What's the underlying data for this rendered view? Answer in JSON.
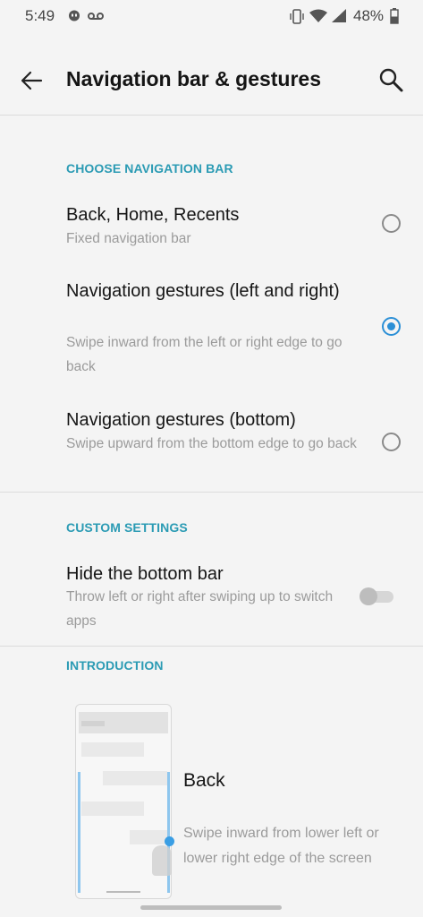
{
  "status_bar": {
    "time": "5:49",
    "battery": "48%",
    "icons": [
      "hangouts-icon",
      "voicemail-icon",
      "vibrate-icon",
      "wifi-icon",
      "signal-icon",
      "battery-icon"
    ]
  },
  "header": {
    "title": "Navigation bar & gestures",
    "back_icon": "back-arrow-icon",
    "search_icon": "search-icon"
  },
  "sections": {
    "choose": {
      "header": "CHOOSE NAVIGATION BAR",
      "options": [
        {
          "title": "Back, Home, Recents",
          "subtitle": "Fixed navigation bar",
          "selected": false
        },
        {
          "title": "Navigation gestures (left and right)",
          "subtitle": "Swipe inward from the left or right edge to go back",
          "selected": true
        },
        {
          "title": "Navigation gestures (bottom)",
          "subtitle": "Swipe upward from the bottom edge to go back",
          "selected": false
        }
      ]
    },
    "custom": {
      "header": "CUSTOM SETTINGS",
      "hide_bottom_bar": {
        "title": "Hide the bottom bar",
        "subtitle": "Throw left or right after swiping up to switch apps",
        "enabled": false
      }
    },
    "intro": {
      "header": "INTRODUCTION",
      "title": "Back",
      "description": "Swipe inward from lower left or lower right edge of the screen"
    }
  },
  "colors": {
    "accent": "#2b9bb4",
    "radio_checked": "#2b8fd6",
    "background": "#f4f4f4"
  }
}
